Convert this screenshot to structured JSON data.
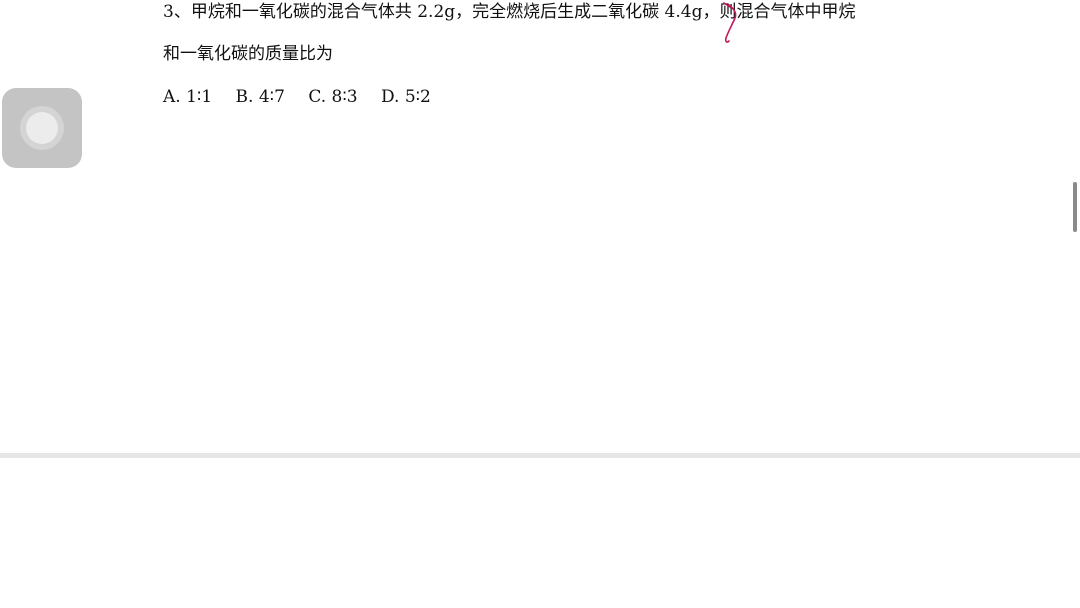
{
  "question": {
    "line1": "3、甲烷和一氧化碳的混合气体共 2.2g，完全燃烧后生成二氧化碳 4.4g，则混合气体中甲烷",
    "line2": "和一氧化碳的质量比为",
    "options": [
      {
        "label": "A. 1∶1"
      },
      {
        "label": "B. 4∶7"
      },
      {
        "label": "C. 8∶3"
      },
      {
        "label": "D. 5∶2"
      }
    ]
  },
  "icons": {
    "assistive_touch": "assistive-touch-icon",
    "annotation": "handwritten-pen-mark",
    "annotation_color": "#c2185b"
  }
}
